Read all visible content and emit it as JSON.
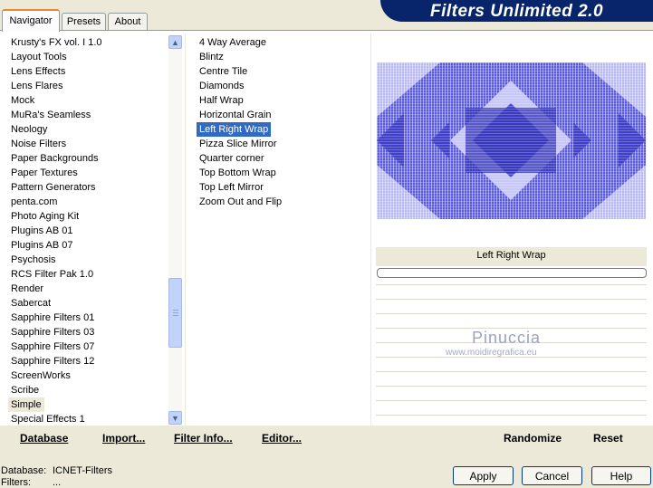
{
  "tabs": [
    {
      "label": "Navigator",
      "active": true
    },
    {
      "label": "Presets",
      "active": false
    },
    {
      "label": "About",
      "active": false
    }
  ],
  "banner": {
    "title": "Filters Unlimited 2.0"
  },
  "categories": {
    "items": [
      "Krusty's FX vol. I 1.0",
      "Layout Tools",
      "Lens Effects",
      "Lens Flares",
      "Mock",
      "MuRa's Seamless",
      "Neology",
      "Noise Filters",
      "Paper Backgrounds",
      "Paper Textures",
      "Pattern Generators",
      "penta.com",
      "Photo Aging Kit",
      "Plugins AB 01",
      "Plugins AB 07",
      "Psychosis",
      "RCS Filter Pak 1.0",
      "Render",
      "Sabercat",
      "Sapphire Filters 01",
      "Sapphire Filters 03",
      "Sapphire Filters 07",
      "Sapphire Filters 12",
      "ScreenWorks",
      "Scribe",
      "Simple",
      "Special Effects 1"
    ],
    "selected": "Simple"
  },
  "filters": {
    "items": [
      "4 Way Average",
      "Blintz",
      "Centre Tile",
      "Diamonds",
      "Half Wrap",
      "Horizontal Grain",
      "Left Right Wrap",
      "Pizza Slice Mirror",
      "Quarter corner",
      "Top Bottom Wrap",
      "Top Left Mirror",
      "Zoom Out and Flip"
    ],
    "selected": "Left Right Wrap"
  },
  "preview": {
    "filter_name": "Left Right Wrap"
  },
  "watermark": {
    "name": "Pinuccia",
    "url": "www.moidiregrafica.eu"
  },
  "bottom_buttons": {
    "database": "Database",
    "import": "Import...",
    "filter_info": "Filter Info...",
    "editor": "Editor...",
    "randomize": "Randomize",
    "reset": "Reset"
  },
  "status": {
    "database_label": "Database:",
    "database_value": "ICNET-Filters",
    "filters_label": "Filters:",
    "filters_value": "..."
  },
  "dialog_buttons": {
    "apply": "Apply",
    "cancel": "Cancel",
    "help": "Help"
  },
  "icons": {
    "scroll_up": "chevron-up-icon",
    "scroll_down": "chevron-down-icon"
  },
  "colors": {
    "banner": "#08246B",
    "selection": "#316AC5",
    "tab_accent": "#E68B2C",
    "preview_base": "#6B6BE6"
  }
}
